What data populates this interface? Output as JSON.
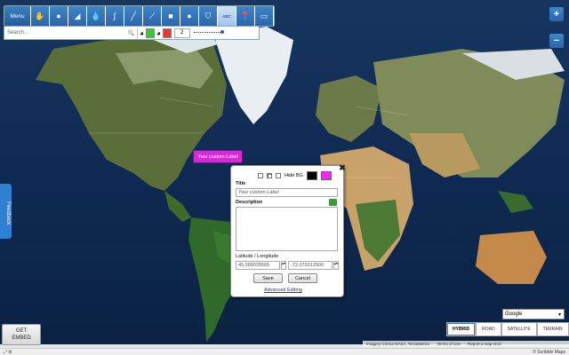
{
  "toolbar": {
    "menu_label": "Menu",
    "tools": [
      {
        "icon": "hand-pointer-icon",
        "glyph": "✋"
      },
      {
        "icon": "blob-icon",
        "glyph": "●"
      },
      {
        "icon": "eraser-icon",
        "glyph": "◢"
      },
      {
        "icon": "fill-drop-icon",
        "glyph": "💧"
      },
      {
        "icon": "freehand-line-icon",
        "glyph": "∫"
      },
      {
        "icon": "straight-line-icon",
        "glyph": "╱"
      },
      {
        "icon": "polyline-icon",
        "glyph": "⟋"
      },
      {
        "icon": "rectangle-icon",
        "glyph": "■"
      },
      {
        "icon": "circle-icon",
        "glyph": "●"
      },
      {
        "icon": "polygon-icon",
        "glyph": "⛉"
      },
      {
        "icon": "text-label-icon",
        "glyph": "ABC",
        "active": true
      },
      {
        "icon": "marker-icon",
        "glyph": "📍"
      },
      {
        "icon": "image-icon",
        "glyph": "▭"
      }
    ]
  },
  "subbar": {
    "search_placeholder": "Search...",
    "stroke_color": "#33cc33",
    "fill_color": "#ee3333",
    "line_width": "2"
  },
  "zoom": {
    "in": "+",
    "out": "−"
  },
  "map_label": {
    "text": "Your custom Label",
    "color": "#d52bd7"
  },
  "popup": {
    "hide_bg_label": "Hide BG",
    "text_color": "#000000",
    "bg_color": "#ff22ff",
    "title_label": "Title",
    "title_value": "Your custom Label",
    "description_label": "Description",
    "latlng_label": "Latitude / Longitude",
    "latitude": "45.089035565",
    "longitude": "-72.070312500",
    "save": "Save",
    "cancel": "Cancel",
    "advanced": "Advanced Editing"
  },
  "feedback": "Feedback",
  "embed": {
    "line1": "GET",
    "line2": "EMBED"
  },
  "map_types": {
    "hybrid": "HYBRID",
    "road": "ROAD",
    "satellite": "SATELLITE",
    "terrain": "TERRAIN"
  },
  "provider": "Google",
  "attribution": {
    "imagery": "Imagery ©2013 NASA, TerraMetrics",
    "terms": "Terms of Use",
    "report": "Report a map error"
  },
  "status": {
    "brand": "© Scribble Maps"
  }
}
